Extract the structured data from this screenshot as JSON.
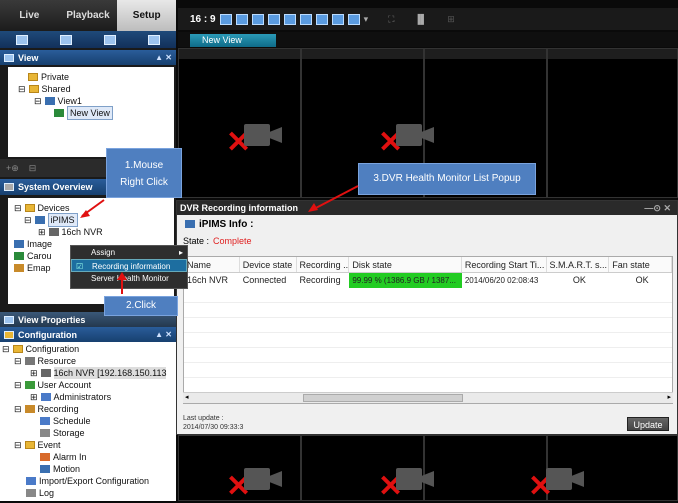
{
  "nav": {
    "tabs": [
      "Live",
      "Playback",
      "Setup"
    ]
  },
  "view_panel": {
    "title": "View",
    "tree": [
      "Private",
      "Shared",
      "View1",
      "New View"
    ]
  },
  "overview_panel": {
    "title": "System Overview",
    "tree": [
      "Devices",
      "iPIMS",
      "16ch NVR",
      "Image",
      "Carou",
      "Emap"
    ]
  },
  "view_properties": {
    "title": "View Properties"
  },
  "config_panel": {
    "title": "Configuration",
    "tree": [
      "Configuration",
      "Resource",
      "16ch NVR [192.168.150.113",
      "User Account",
      "Administrators",
      "Recording",
      "Schedule",
      "Storage",
      "Event",
      "Alarm In",
      "Motion",
      "Import/Export Configuration",
      "Log"
    ]
  },
  "toolbar": {
    "ratio": "16 : 9"
  },
  "view_tab": "New View",
  "context_menu": {
    "items": [
      "Assign",
      "Recording information",
      "Server Health Monitor"
    ]
  },
  "callouts": {
    "c1_line1": "1.Mouse",
    "c1_line2": "Right Click",
    "c2": "2.Click",
    "c3": "3.DVR Health Monitor List Popup"
  },
  "dialog": {
    "title": "DVR Recording information",
    "info_label": "iPIMS Info :",
    "state_label": "State :",
    "state_value": "Complete",
    "columns": [
      "Name",
      "Device state",
      "Recording ...",
      "Disk state",
      "Recording Start Ti...",
      "S.M.A.R.T. s...",
      "Fan state"
    ],
    "rows": [
      {
        "name": "16ch NVR",
        "device_state": "Connected",
        "recording": "Recording",
        "disk_state": "99.99 % (1386.9 GB / 1387...",
        "start": "2014/06/20 02:08:43",
        "smart": "OK",
        "fan": "OK"
      }
    ],
    "last_update_label": "Last update :",
    "last_update_value": "2014/07/30 09:33:3",
    "update_button": "Update"
  },
  "colors": {
    "accent": "#2a5d9a",
    "status_red": "#e02020",
    "disk_green": "#22cc22"
  }
}
